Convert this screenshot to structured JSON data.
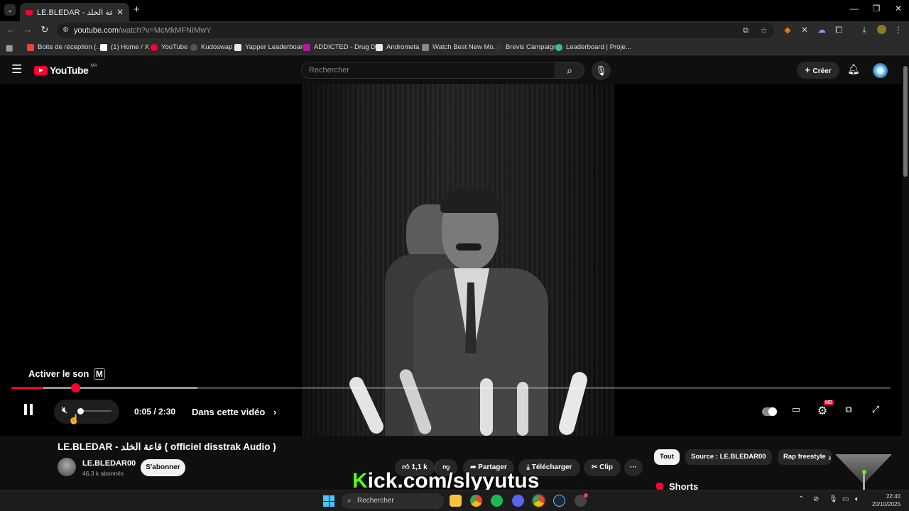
{
  "browser": {
    "tab_title": "LE.BLEDAR - قاعة الخلد ( officiel disstrak Audio )",
    "tab_close": "✕",
    "new_tab": "+",
    "url_host": "youtube.com",
    "url_path": "/watch?v=McMkMFNIMwY",
    "bookmarks": [
      {
        "label": "Boite de réception (...",
        "color": "#ea4335"
      },
      {
        "label": "(1) Home / X",
        "color": "#ffffff"
      },
      {
        "label": "YouTube",
        "color": "#ff0033"
      },
      {
        "label": "Kudoswap",
        "color": "#555555"
      },
      {
        "label": "Yapper Leaderboard",
        "color": "#e8e8e8"
      },
      {
        "label": "ADDICTED - Drug D...",
        "color": "#b5179e"
      },
      {
        "label": "Andrometa",
        "color": "#e8e8e8"
      },
      {
        "label": "Watch Best New Mo...",
        "color": "#888888"
      },
      {
        "label": "Brevis Campaign",
        "color": "#333333"
      },
      {
        "label": "Leaderboard | Proje...",
        "color": "#2ecc71"
      }
    ]
  },
  "youtube": {
    "logo_text": "YouTube",
    "region": "MA",
    "search_placeholder": "Rechercher",
    "create_label": "Créer"
  },
  "player": {
    "unmute_label": "Activer le son",
    "unmute_key": "M",
    "time_display": "0:05 / 2:30",
    "chapter_label": "Dans cette vidéo",
    "hd_badge": "HD",
    "progress_played_fraction": 0.036,
    "progress_buffered_fraction": 0.212,
    "volume_fraction": 0.0
  },
  "video": {
    "title": "LE.BLEDAR - قاعة الخلد ( officiel disstrak Audio )",
    "channel": "LE.BLEDAR00",
    "subscribers": "46,3 k abonnés",
    "subscribe_label": "S'abonner",
    "likes": "1,1 k",
    "share_label": "Partager",
    "download_label": "Télécharger",
    "clip_label": "Clip",
    "more_label": "···"
  },
  "chips": [
    "Tout",
    "Source : LE.BLEDAR00",
    "Rap freestyle"
  ],
  "shorts_label": "Shorts",
  "overlay": {
    "brand_letter": "K",
    "rest": "ick.com/slyyutus"
  },
  "taskbar": {
    "search_label": "Rechercher",
    "time": "22:40",
    "date": "20/10/2025"
  }
}
